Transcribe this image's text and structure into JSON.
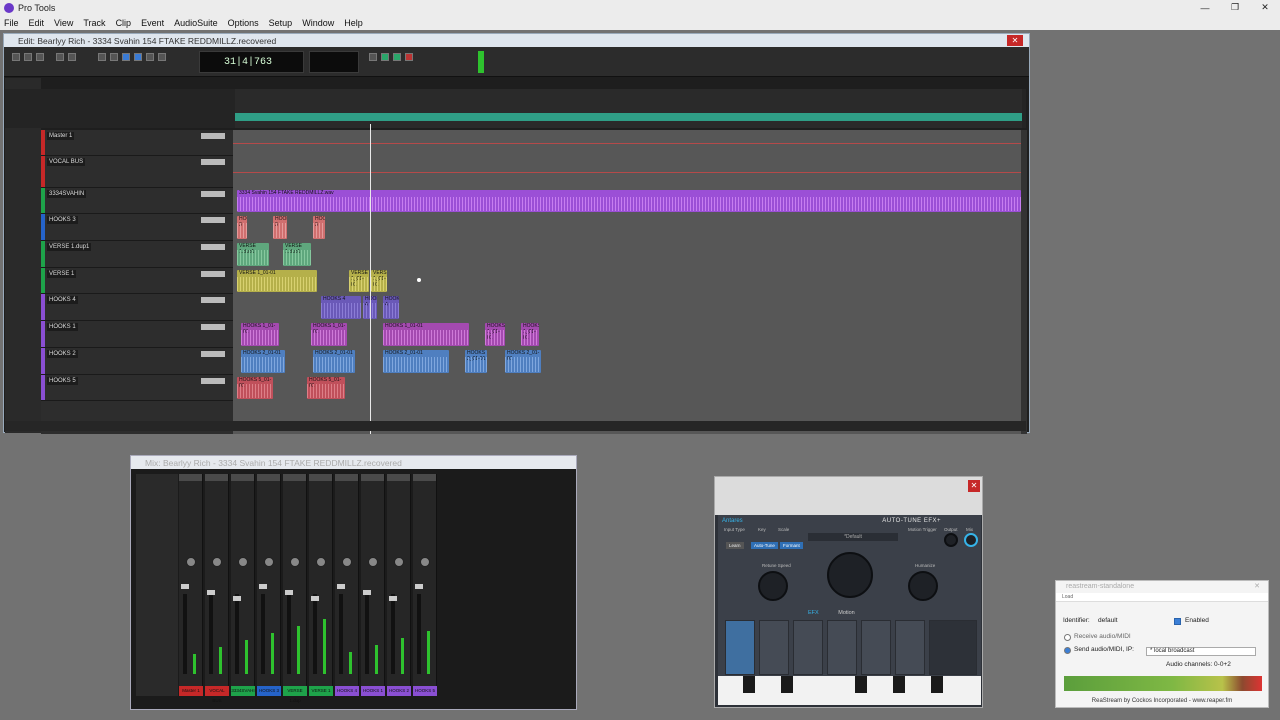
{
  "app": {
    "title": "Pro Tools",
    "window_controls": [
      "—",
      "❐",
      "✕"
    ]
  },
  "menu": [
    "File",
    "Edit",
    "View",
    "Track",
    "Clip",
    "Event",
    "AudioSuite",
    "Options",
    "Setup",
    "Window",
    "Help"
  ],
  "edit_window": {
    "title": "Edit: Bearlyy Rich - 3334 Svahin 154 FTAKE REDDMILLZ.recovered",
    "counter": "31|4|763",
    "tracks": [
      {
        "name": "Master 1",
        "color": "#c62828"
      },
      {
        "name": "VOCAL BUS",
        "color": "#c62828"
      },
      {
        "name": "3334SVAHIN",
        "color": "#1ea34a"
      },
      {
        "name": "HOOKS 3",
        "color": "#2563c9"
      },
      {
        "name": "VERSE 1.dup1",
        "color": "#1ea34a"
      },
      {
        "name": "VERSE 1",
        "color": "#1ea34a"
      },
      {
        "name": "HOOKS 4",
        "color": "#8a4fd3"
      },
      {
        "name": "HOOKS 1",
        "color": "#8a4fd3"
      },
      {
        "name": "HOOKS 2",
        "color": "#8a4fd3"
      },
      {
        "name": "HOOKS 5",
        "color": "#8a4fd3"
      }
    ],
    "clip_labels": {
      "beat": "3334 Svahin 154 FTAKE REDDMILLZ.wav",
      "hooks3": "HOOKS 3",
      "verse_dup": "VERSE 1.dup1",
      "verse1": "VERSE 1_01-01",
      "hooks4": "HOOKS 4",
      "hooks1": "HOOKS 1_01-01",
      "hooks2": "HOOKS 2_01-01",
      "hooks5": "HOOKS 5_01-01"
    }
  },
  "mix_window": {
    "title": "Mix: Bearlyy Rich - 3334 Svahin 154 FTAKE REDDMILLZ.recovered",
    "channels": [
      "Master 1",
      "VOCAL BUS",
      "3334SVAHI",
      "HOOKS 3",
      "VERSE 1.dup",
      "VERSE 1",
      "HOOKS 4",
      "HOOKS 1",
      "HOOKS 2",
      "HOOKS 5"
    ]
  },
  "autotune": {
    "brand": "Antares",
    "product": "AUTO-TUNE EFX+",
    "preset": "*Default",
    "labels": {
      "input_type": "Input Type",
      "key": "Key",
      "scale": "Scale",
      "retune_speed": "Retune Speed",
      "humanize": "Humanize",
      "learn": "Learn",
      "auto_tune": "Auto-Tune",
      "formant": "Formant",
      "motion_trigger": "Motion Trigger",
      "output": "Output",
      "mix": "Mix"
    },
    "tabs": [
      "EFX",
      "Motion"
    ]
  },
  "reastream": {
    "title": "reastream-standalone",
    "menu": "Load",
    "identifier_label": "Identifier:",
    "identifier_value": "default",
    "enabled_label": "Enabled",
    "enabled": true,
    "receive_label": "Receive audio/MIDI",
    "send_label": "Send audio/MIDI, IP:",
    "ip_value": "* local broadcast",
    "channels_label": "Audio channels: 0-0+2",
    "footer": "ReaStream by Cockos Incorporated - www.reaper.fm"
  }
}
